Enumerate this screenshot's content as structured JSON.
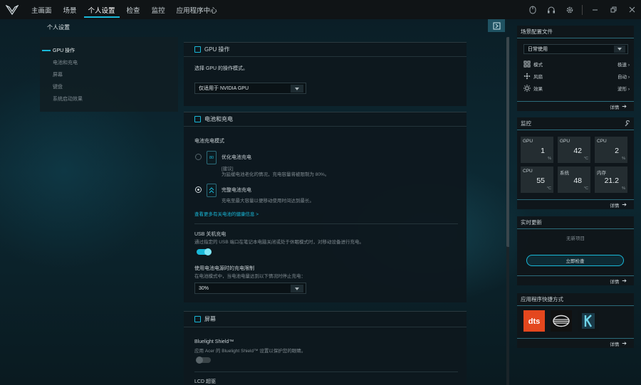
{
  "nav": {
    "items": [
      "主画面",
      "场景",
      "个人设置",
      "检查",
      "监控",
      "应用程序中心"
    ],
    "active_index": 2
  },
  "top_icons": [
    "mouse-icon",
    "headset-icon",
    "settings-gear-icon",
    "minimize-icon",
    "restore-icon",
    "close-icon"
  ],
  "page": {
    "title": "个人设置"
  },
  "subnav": {
    "items": [
      "GPU 操作",
      "电池和充电",
      "屏幕",
      "键盘",
      "系统启动效果"
    ],
    "active_index": 0
  },
  "gpu": {
    "title": "GPU 操作",
    "prompt": "选择 GPU 的操作模式。",
    "mode_value": "仅适用于 NVIDIA GPU"
  },
  "battery": {
    "title": "电池和充电",
    "mode_label": "电池充电模式",
    "optimized": {
      "title": "优化电池充电",
      "icon_text": "80",
      "line1": "[建议]",
      "line2": "为延缓电池老化的情况，充电容量将被限制为 80%。",
      "selected": false
    },
    "full": {
      "title": "完整电池充电",
      "desc": "充电至最大容量以便移动使用时间达到最长。",
      "selected": true
    },
    "health_link": "查看更多有关电池的健康信息 >",
    "usb": {
      "title": "USB 关机充电",
      "desc": "通过指定的 USB 端口在笔记本电脑关闭或处于休眠模式时，对移动设备进行充电。",
      "enabled": true
    },
    "limit": {
      "title": "使用电池电源时的充电限制",
      "desc": "在电池模式中，当电池电量达到以下情况时停止充电：",
      "value": "30%"
    }
  },
  "screen": {
    "title": "屏幕",
    "bluelight_title": "Bluelight Shield™",
    "bluelight_desc": "应用 Acer 的 Bluelight Shield™ 设置以保护您的眼睛。",
    "bluelight_enabled": false,
    "lcd_title": "LCD 超驱"
  },
  "profile": {
    "title": "场景配置文件",
    "selected": "日常使用",
    "rows": [
      {
        "icon": "mode-icon",
        "label": "模式",
        "value": "极速"
      },
      {
        "icon": "fan-icon",
        "label": "风扇",
        "value": "自动"
      },
      {
        "icon": "sun-effect-icon",
        "label": "效果",
        "value": "波形"
      }
    ],
    "details": "详情"
  },
  "monitor": {
    "title": "监控",
    "tiles": [
      {
        "label": "GPU",
        "value": "1",
        "unit": "%"
      },
      {
        "label": "GPU",
        "value": "42",
        "unit": "°C"
      },
      {
        "label": "CPU",
        "value": "2",
        "unit": "%"
      },
      {
        "label": "CPU",
        "value": "55",
        "unit": "°C"
      },
      {
        "label": "系统",
        "value": "48",
        "unit": "°C"
      },
      {
        "label": "内存",
        "value": "21.2",
        "unit": "%"
      }
    ],
    "details": "详情"
  },
  "updates": {
    "title": "实时更新",
    "empty": "无新项目",
    "check_button": "立即检查",
    "details": "详情"
  },
  "shortcuts": {
    "title": "应用程序快捷方式",
    "apps": [
      "dts-app-icon",
      "audio-app-icon",
      "k-app-icon"
    ],
    "details": "详情"
  },
  "colors": {
    "accent": "#19b8d8",
    "topbar": "#101416"
  }
}
